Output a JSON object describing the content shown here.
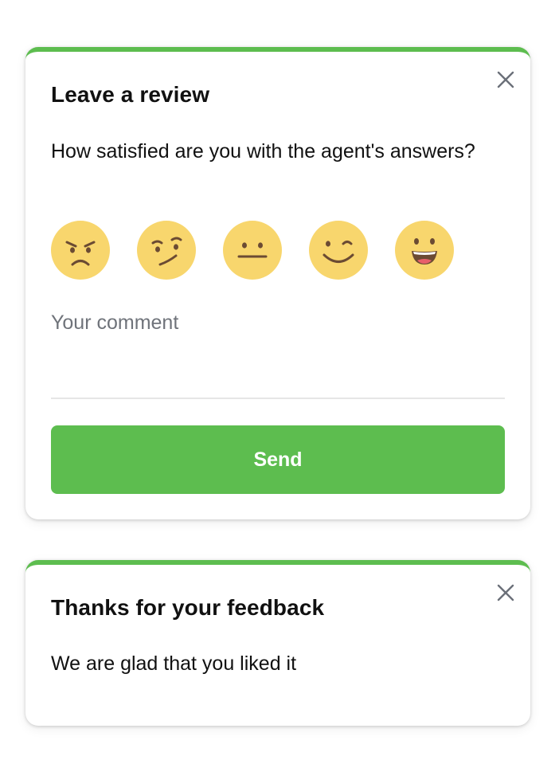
{
  "colors": {
    "accent": "#5dbd4f",
    "emoji_face": "#f8d66d",
    "emoji_feature": "#6b4b33",
    "close_icon": "#6b7079",
    "placeholder_text": "#6f737a"
  },
  "review_card": {
    "title": "Leave a review",
    "question": "How satisfied are you with the agent's answers?",
    "close_icon": "close-icon",
    "rating_options": [
      {
        "icon": "angry-face-icon"
      },
      {
        "icon": "skeptical-face-icon"
      },
      {
        "icon": "neutral-face-icon"
      },
      {
        "icon": "smiling-face-icon"
      },
      {
        "icon": "grinning-face-icon"
      }
    ],
    "comment_placeholder": "Your comment",
    "comment_value": "",
    "send_label": "Send"
  },
  "thanks_card": {
    "title": "Thanks for your feedback",
    "message": "We are glad that you liked it",
    "close_icon": "close-icon"
  }
}
